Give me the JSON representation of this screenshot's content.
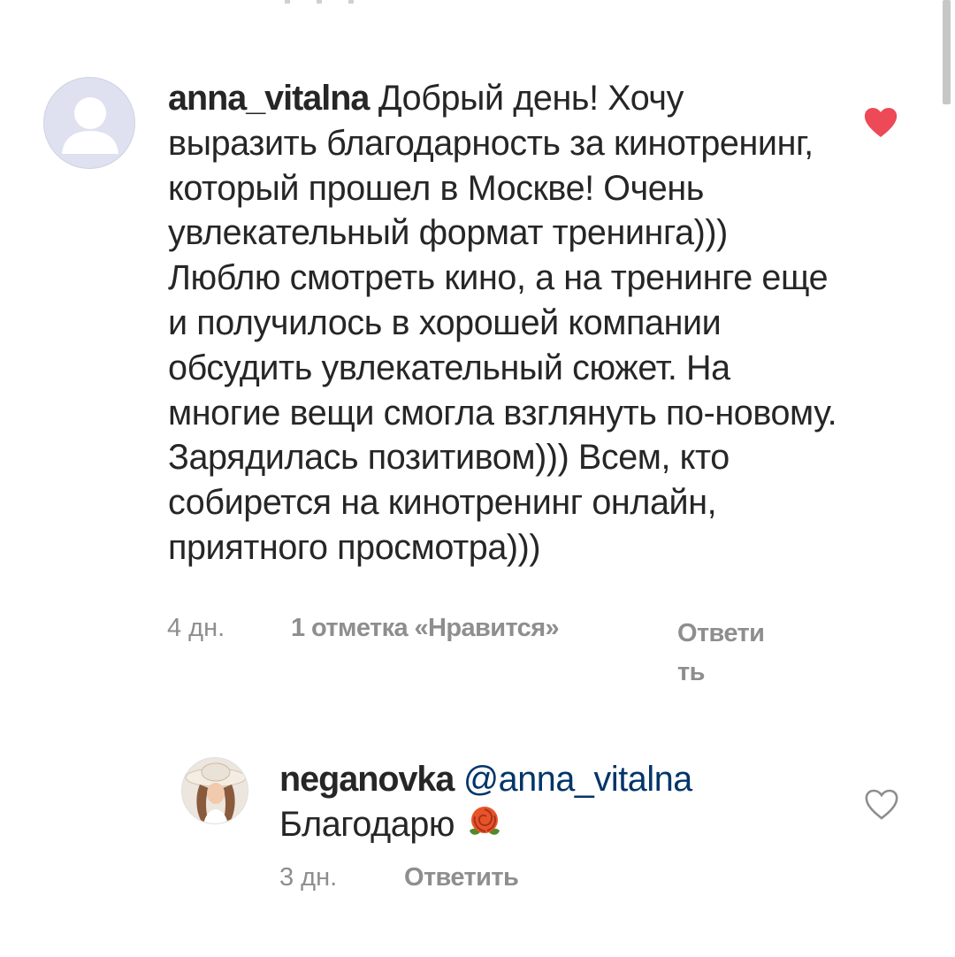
{
  "comments": [
    {
      "username": "anna_vitalna",
      "text": "Добрый день! Хочу выразить благодарность за кинотренинг, который прошел в Москве! Очень увлекательный формат тренинга))) Люблю смотреть кино, а на тренинге еще и получилось в хорошей компании обсудить увлекательный сюжет. На многие вещи смогла взглянуть по-новому. Зарядилась позитивом))) Всем, кто собирется на кинотренинг онлайн, приятного просмотра)))",
      "time": "4 дн.",
      "likes": "1 отметка «Нравится»",
      "reply": "Ответить",
      "liked": true,
      "avatar": "default-user-avatar",
      "like_icon": "heart-filled-icon",
      "like_color": "#ed4956"
    },
    {
      "username": "neganovka",
      "mention": "@anna_vitalna",
      "text": "Благодарю",
      "emoji": "rose-emoji",
      "time": "3 дн.",
      "reply": "Ответить",
      "liked": false,
      "avatar": "user-photo-avatar",
      "like_icon": "heart-outline-icon"
    }
  ],
  "colors": {
    "text": "#262626",
    "meta": "#8e8e8e",
    "mention": "#003569",
    "like": "#ed4956"
  }
}
